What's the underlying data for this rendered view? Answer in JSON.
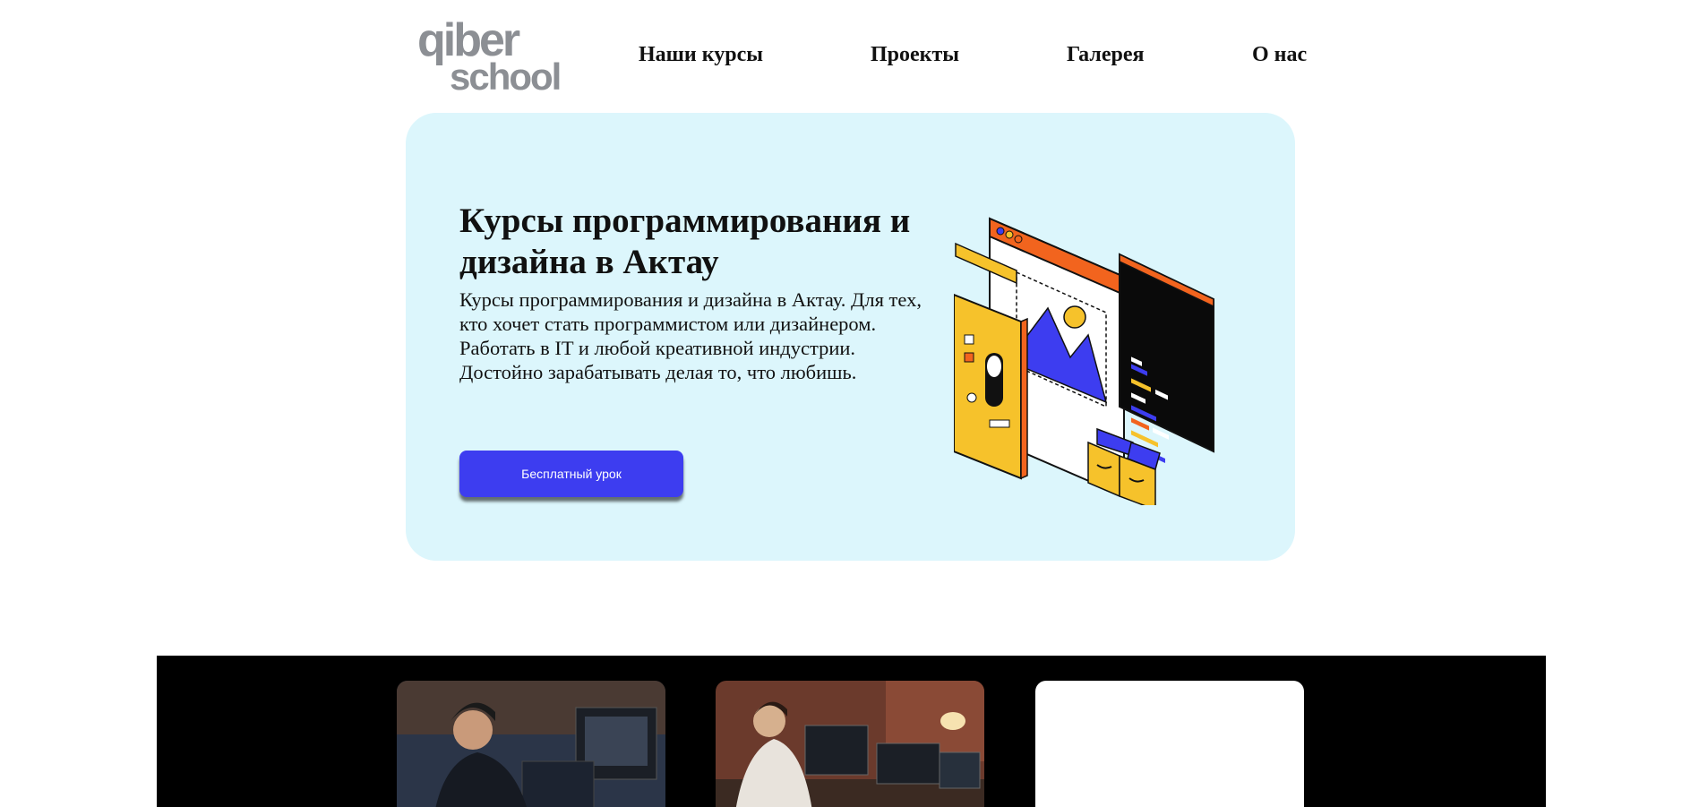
{
  "logo": {
    "line1": "qiber",
    "line2": "school",
    "color": "#8c8f94"
  },
  "nav": {
    "items": [
      {
        "label": "Наши курсы"
      },
      {
        "label": "Проекты"
      },
      {
        "label": "Галерея"
      },
      {
        "label": "О нас"
      }
    ]
  },
  "hero": {
    "title": "Курсы программирования и дизайна в Актау",
    "description": "Курсы программирования и дизайна в Актау. Для тех, кто хочет стать программистом или дизайнером. Работать в IT и любой креативной индустрии. Достойно зарабатывать делая то, что любишь.",
    "cta_label": "Бесплатный урок",
    "background": "#dcf6fc",
    "accent": "#3d3df0"
  },
  "illustration": {
    "icon": "code-and-design-illustration"
  },
  "gallery": {
    "cards": [
      {
        "icon": "photo-developer-at-monitors"
      },
      {
        "icon": "photo-developer-at-desk"
      },
      {
        "icon": "empty-white-card"
      }
    ]
  }
}
